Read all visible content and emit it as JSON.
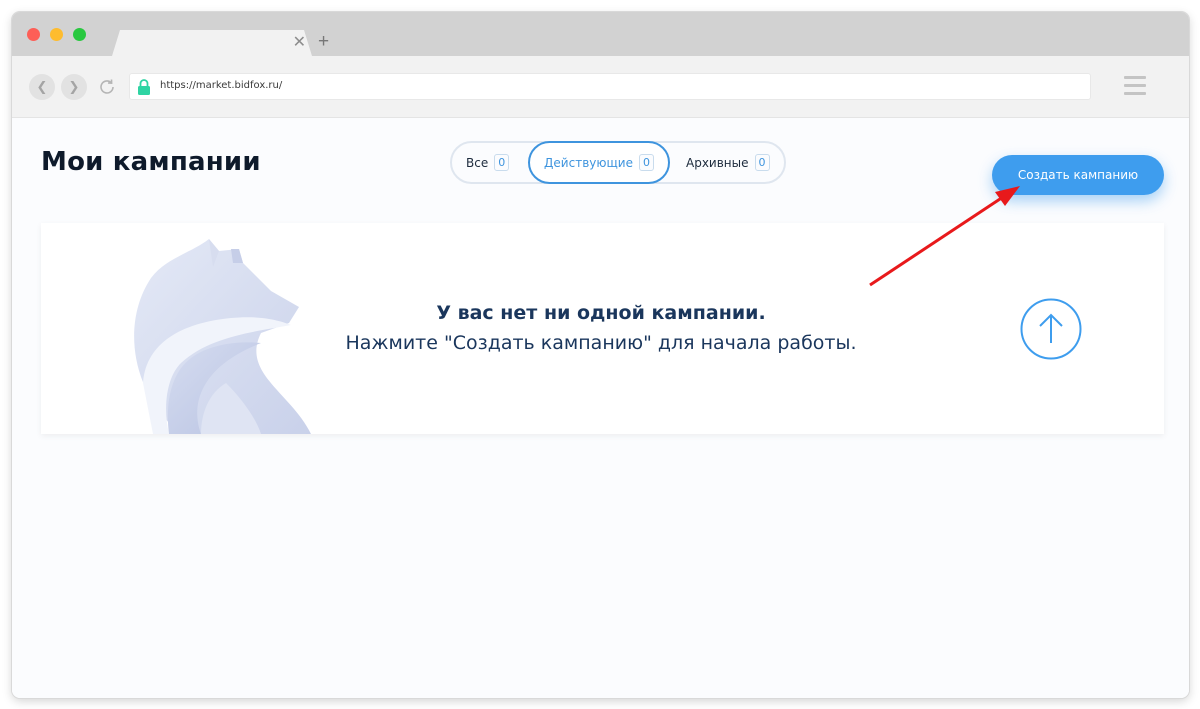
{
  "browser": {
    "url": "https://market.bidfox.ru/",
    "tab_close": "✕",
    "new_tab": "+"
  },
  "page": {
    "title": "Мои кампании",
    "filters": [
      {
        "label": "Все",
        "count": "0"
      },
      {
        "label": "Действующие",
        "count": "0"
      },
      {
        "label": "Архивные",
        "count": "0"
      }
    ],
    "create_button": "Создать кампанию",
    "empty_state": {
      "title": "У вас нет ни одной кампании.",
      "subtitle": "Нажмите \"Создать кампанию\" для начала работы."
    }
  },
  "colors": {
    "accent": "#3e9dee",
    "active_filter": "#3e94de",
    "text_dark": "#1a365c",
    "annotation_arrow": "#e8191b"
  },
  "icons": [
    "lock-icon",
    "back-icon",
    "forward-icon",
    "reload-icon",
    "menu-icon",
    "arrow-up-icon",
    "fox-illustration"
  ]
}
